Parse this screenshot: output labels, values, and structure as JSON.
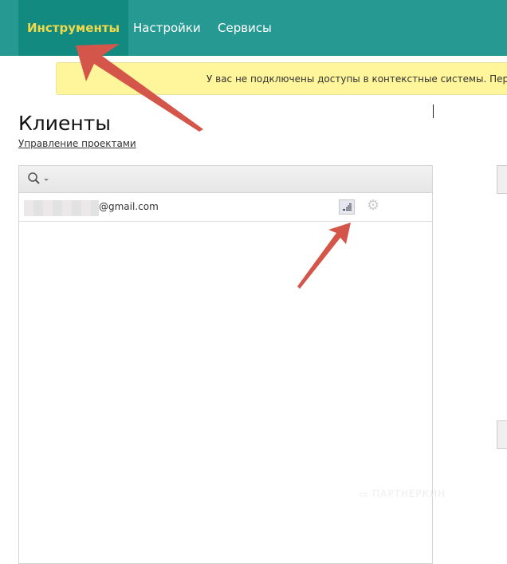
{
  "nav": {
    "tabs": [
      {
        "label": "Инструменты",
        "active": true
      },
      {
        "label": "Настройки"
      },
      {
        "label": "Сервисы"
      }
    ]
  },
  "banner": {
    "text": "У вас не подключены доступы в контекстные системы. Пер"
  },
  "page": {
    "title": "Клиенты",
    "manage_link": "Управление проектами"
  },
  "clients": [
    {
      "email": "@gmail.com"
    }
  ],
  "watermark": "ПАРТНЕРКИН",
  "colors": {
    "nav": "#269a92",
    "active_tab": "#128a80",
    "active_text": "#f2d94a",
    "banner": "#fff59b",
    "arrow": "#d4564a"
  }
}
